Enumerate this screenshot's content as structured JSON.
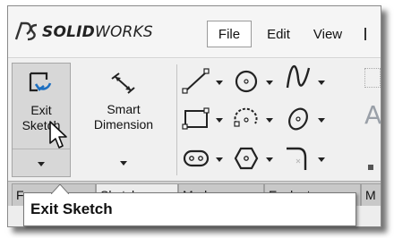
{
  "app": {
    "logo_brand_prefix": "SOLID",
    "logo_brand_suffix": "WORKS"
  },
  "menu": {
    "items": [
      {
        "label": "File",
        "active": true
      },
      {
        "label": "Edit"
      },
      {
        "label": "View"
      }
    ]
  },
  "commands": {
    "exit_sketch": {
      "line1": "Exit",
      "line2": "Sketch",
      "icon": "exit-sketch-icon"
    },
    "smart_dimension": {
      "line1": "Smart",
      "line2": "Dimension",
      "icon": "smart-dimension-icon"
    },
    "tools": [
      {
        "icon": "line-icon"
      },
      {
        "icon": "circle-icon"
      },
      {
        "icon": "spline-icon"
      },
      {
        "icon": "rectangle-icon"
      },
      {
        "icon": "arc-icon"
      },
      {
        "icon": "ellipse-icon"
      },
      {
        "icon": "slot-icon"
      },
      {
        "icon": "polygon-icon"
      },
      {
        "icon": "fillet-icon"
      }
    ],
    "text_tool_glyph": "A"
  },
  "tabs": [
    {
      "label": "Fe"
    },
    {
      "label": "Sketch",
      "active": true
    },
    {
      "label": "Markup"
    },
    {
      "label": "Evaluate"
    },
    {
      "label": "M"
    }
  ],
  "tooltip": {
    "text": "Exit Sketch"
  },
  "colors": {
    "button_pressed": "#d7d7d7",
    "menu_bg": "#f5f5f5",
    "tab_bg": "#c8c8c8",
    "tooltip_bg": "#ffffff"
  }
}
